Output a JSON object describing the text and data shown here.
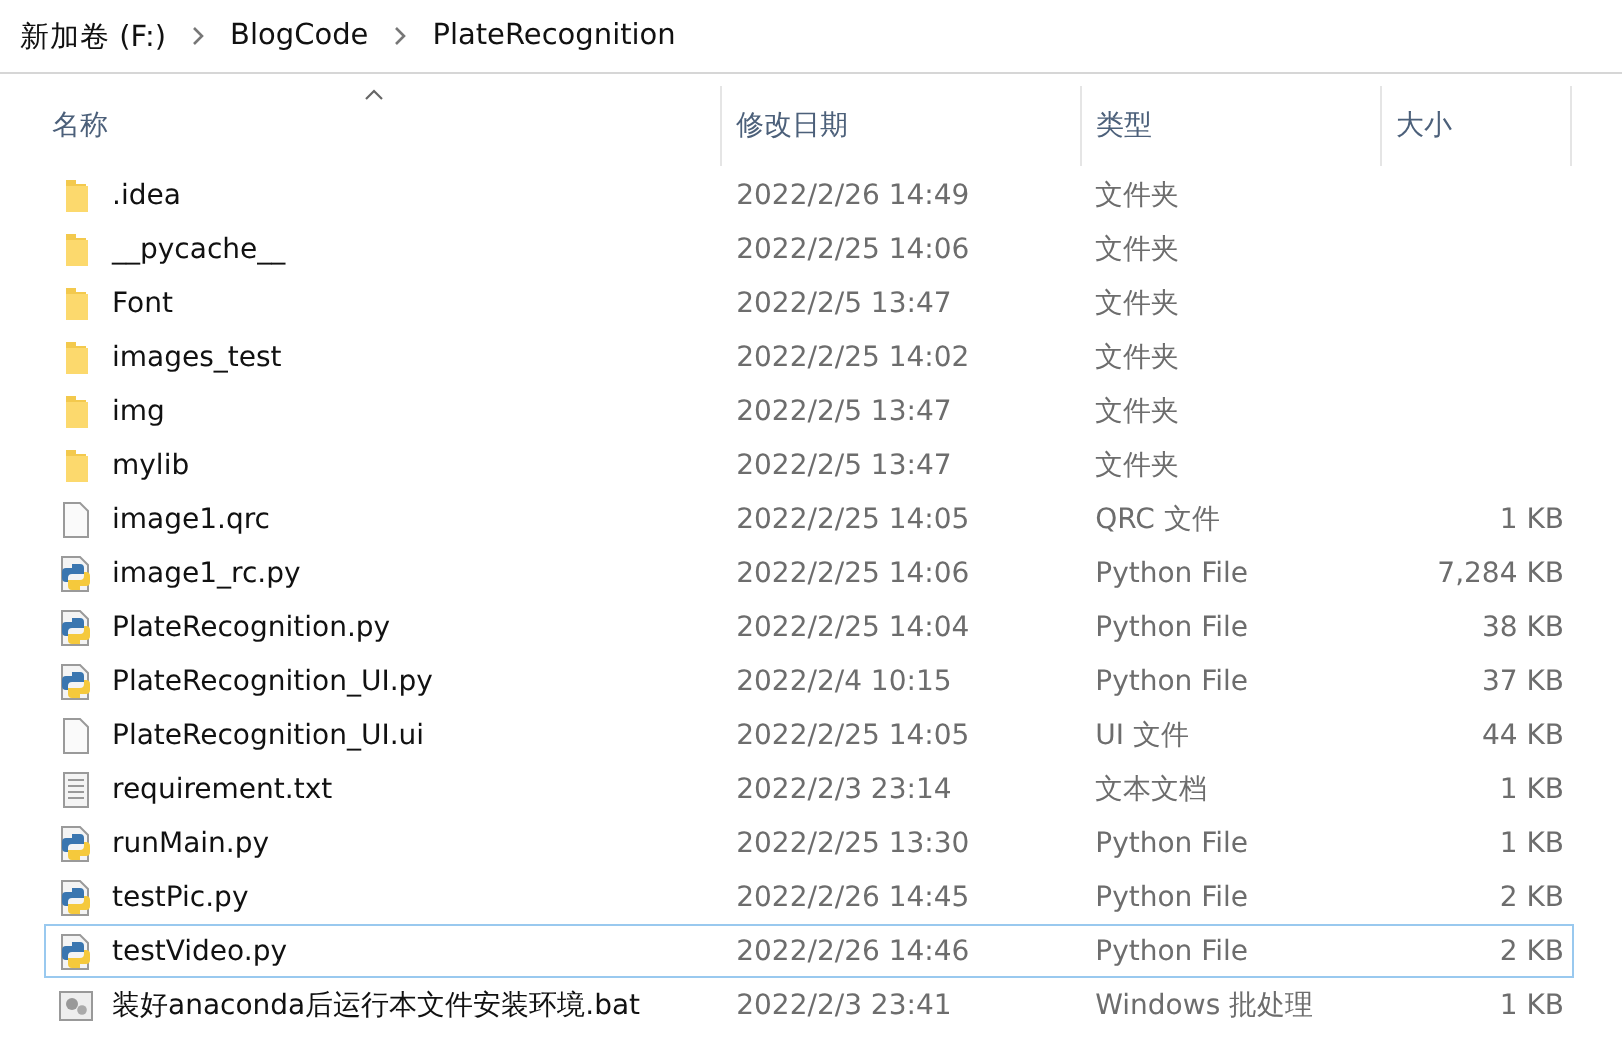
{
  "breadcrumb": [
    "新加卷 (F:)",
    "BlogCode",
    "PlateRecognition"
  ],
  "columns": [
    {
      "label": "名称",
      "sorted": true
    },
    {
      "label": "修改日期",
      "sorted": false
    },
    {
      "label": "类型",
      "sorted": false
    },
    {
      "label": "大小",
      "sorted": false
    }
  ],
  "files": [
    {
      "name": ".idea",
      "date": "2022/2/26 14:49",
      "type": "文件夹",
      "kind": "folder",
      "focused": false
    },
    {
      "name": "__pycache__",
      "date": "2022/2/25 14:06",
      "type": "文件夹",
      "kind": "folder",
      "focused": false
    },
    {
      "name": "Font",
      "date": "2022/2/5 13:47",
      "type": "文件夹",
      "kind": "folder",
      "focused": false
    },
    {
      "name": "images_test",
      "date": "2022/2/25 14:02",
      "type": "文件夹",
      "kind": "folder",
      "focused": false
    },
    {
      "name": "img",
      "date": "2022/2/5 13:47",
      "type": "文件夹",
      "kind": "folder",
      "focused": false
    },
    {
      "name": "mylib",
      "date": "2022/2/5 13:47",
      "type": "文件夹",
      "kind": "folder",
      "focused": false
    },
    {
      "name": "image1.qrc",
      "date": "2022/2/25 14:05",
      "type": "QRC 文件",
      "size": "1 KB",
      "kind": "blank",
      "focused": false
    },
    {
      "name": "image1_rc.py",
      "date": "2022/2/25 14:06",
      "type": "Python File",
      "size": "7,284 KB",
      "kind": "python",
      "focused": false
    },
    {
      "name": "PlateRecognition.py",
      "date": "2022/2/25 14:04",
      "type": "Python File",
      "size": "38 KB",
      "kind": "python",
      "focused": false
    },
    {
      "name": "PlateRecognition_UI.py",
      "date": "2022/2/4 10:15",
      "type": "Python File",
      "size": "37 KB",
      "kind": "python",
      "focused": false
    },
    {
      "name": "PlateRecognition_UI.ui",
      "date": "2022/2/25 14:05",
      "type": "UI 文件",
      "size": "44 KB",
      "kind": "blank",
      "focused": false
    },
    {
      "name": "requirement.txt",
      "date": "2022/2/3 23:14",
      "type": "文本文档",
      "size": "1 KB",
      "kind": "text",
      "focused": false
    },
    {
      "name": "runMain.py",
      "date": "2022/2/25 13:30",
      "type": "Python File",
      "size": "1 KB",
      "kind": "python",
      "focused": false
    },
    {
      "name": "testPic.py",
      "date": "2022/2/26 14:45",
      "type": "Python File",
      "size": "2 KB",
      "kind": "python",
      "focused": false
    },
    {
      "name": "testVideo.py",
      "date": "2022/2/26 14:46",
      "type": "Python File",
      "size": "2 KB",
      "kind": "python",
      "focused": true
    },
    {
      "name": "装好anaconda后运行本文件安装环境.bat",
      "date": "2022/2/3 23:41",
      "type": "Windows 批处理",
      "size": "1 KB",
      "kind": "batch",
      "focused": false
    }
  ]
}
